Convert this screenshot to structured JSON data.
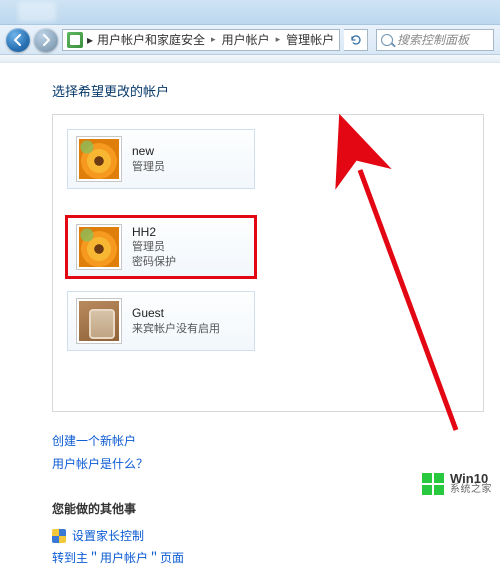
{
  "breadcrumb": {
    "items": [
      "用户帐户和家庭安全",
      "用户帐户",
      "管理帐户"
    ],
    "chevron": "▸"
  },
  "search": {
    "placeholder": "搜索控制面板"
  },
  "heading": "选择希望更改的帐户",
  "accounts": [
    {
      "name": "new",
      "role": "管理员",
      "extra": ""
    },
    {
      "name": "HH2",
      "role": "管理员",
      "extra": "密码保护"
    },
    {
      "name": "Guest",
      "role": "来宾帐户没有启用",
      "extra": ""
    }
  ],
  "links": {
    "create": "创建一个新帐户",
    "whatis": "用户帐户是什么？"
  },
  "other": {
    "heading": "您能做的其他事",
    "parental": "设置家长控制",
    "gomain": "转到主＂用户帐户＂页面"
  },
  "watermark": {
    "line1": "Win10",
    "line2": "系统之家"
  }
}
